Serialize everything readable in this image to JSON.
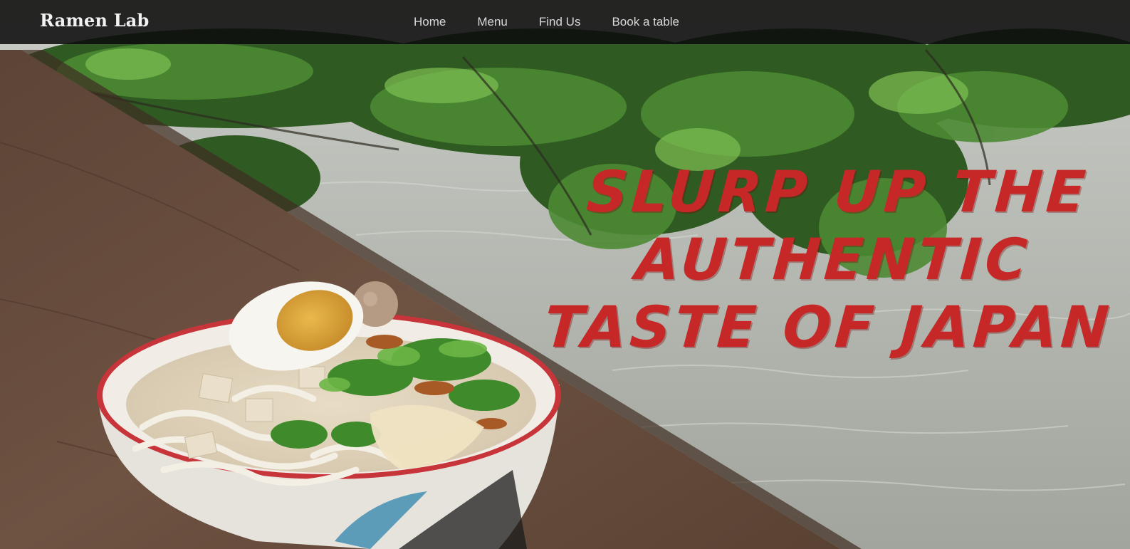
{
  "nav": {
    "brand": "Ramen Lab",
    "links": [
      {
        "label": "Home"
      },
      {
        "label": "Menu"
      },
      {
        "label": "Find Us"
      },
      {
        "label": "Book a table"
      }
    ]
  },
  "hero": {
    "headline_lines": [
      "SLURP UP THE",
      "AUTHENTIC",
      "TASTE OF JAPAN"
    ],
    "headline_color": "#c62828"
  },
  "colors": {
    "navbar_bg": "#0c0c0c",
    "nav_text": "#d9d9d9",
    "brand_text": "#f2f2f2"
  }
}
